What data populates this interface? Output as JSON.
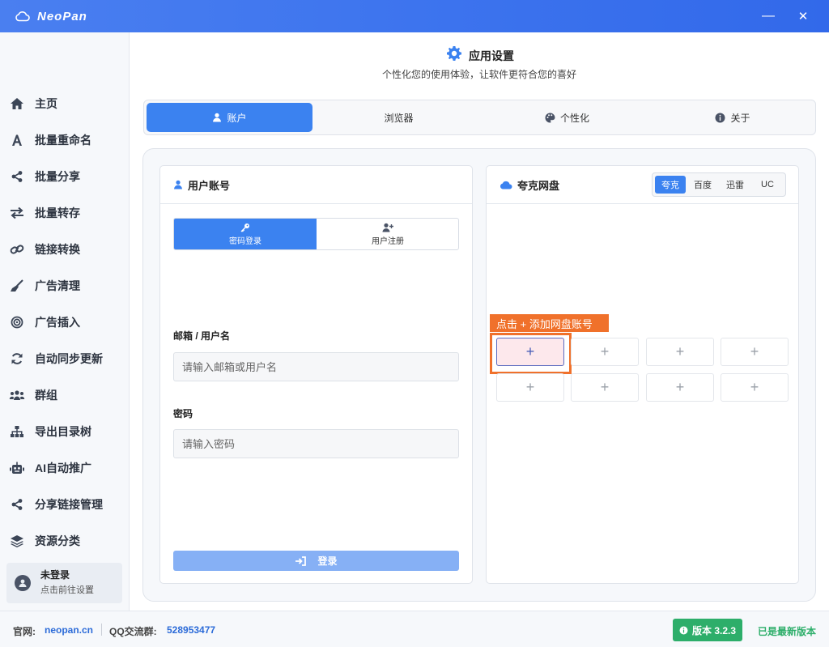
{
  "app": {
    "name": "NeoPan"
  },
  "window": {
    "minimize": "—",
    "close": "✕"
  },
  "sidebar": {
    "items": [
      {
        "label": "主页",
        "icon": "home-icon"
      },
      {
        "label": "批量重命名",
        "icon": "font-icon"
      },
      {
        "label": "批量分享",
        "icon": "share-icon"
      },
      {
        "label": "批量转存",
        "icon": "transfer-icon"
      },
      {
        "label": "链接转换",
        "icon": "link-icon"
      },
      {
        "label": "广告清理",
        "icon": "broom-icon"
      },
      {
        "label": "广告插入",
        "icon": "target-icon"
      },
      {
        "label": "自动同步更新",
        "icon": "sync-icon"
      },
      {
        "label": "群组",
        "icon": "users-icon"
      },
      {
        "label": "导出目录树",
        "icon": "sitemap-icon"
      },
      {
        "label": "AI自动推广",
        "icon": "robot-icon"
      },
      {
        "label": "分享链接管理",
        "icon": "share-icon"
      },
      {
        "label": "资源分类",
        "icon": "layers-icon"
      }
    ],
    "user": {
      "name": "未登录",
      "hint": "点击前往设置"
    }
  },
  "header": {
    "title": "应用设置",
    "subtitle": "个性化您的使用体验，让软件更符合您的喜好"
  },
  "tabs": [
    {
      "label": "账户",
      "icon": "user-icon",
      "active": true
    },
    {
      "label": "浏览器",
      "icon": "",
      "active": false
    },
    {
      "label": "个性化",
      "icon": "palette-icon",
      "active": false
    },
    {
      "label": "关于",
      "icon": "info-icon",
      "active": false
    }
  ],
  "account_card": {
    "title": "用户账号",
    "mode_tabs": [
      {
        "label": "密码登录",
        "icon": "key-icon",
        "active": true
      },
      {
        "label": "用户注册",
        "icon": "user-plus-icon",
        "active": false
      }
    ],
    "email_label": "邮箱 / 用户名",
    "email_placeholder": "请输入邮箱或用户名",
    "password_label": "密码",
    "password_placeholder": "请输入密码",
    "login_button": "登录"
  },
  "cloud_card": {
    "title": "夸克网盘",
    "providers": [
      {
        "label": "夸克",
        "active": true
      },
      {
        "label": "百度",
        "active": false
      },
      {
        "label": "迅雷",
        "active": false
      },
      {
        "label": "UC",
        "active": false
      }
    ],
    "tip": "点击 + 添加网盘账号",
    "slot_symbol": "+"
  },
  "footer": {
    "site_label": "官网:",
    "site_value": "neopan.cn",
    "qq_label": "QQ交流群:",
    "qq_value": "528953477",
    "version": "版本 3.2.3",
    "version_status": "已是最新版本"
  },
  "colors": {
    "accent": "#3b82f0",
    "title_bar": "#3d74ee",
    "highlight": "#f0712b",
    "success": "#2dae6a"
  }
}
